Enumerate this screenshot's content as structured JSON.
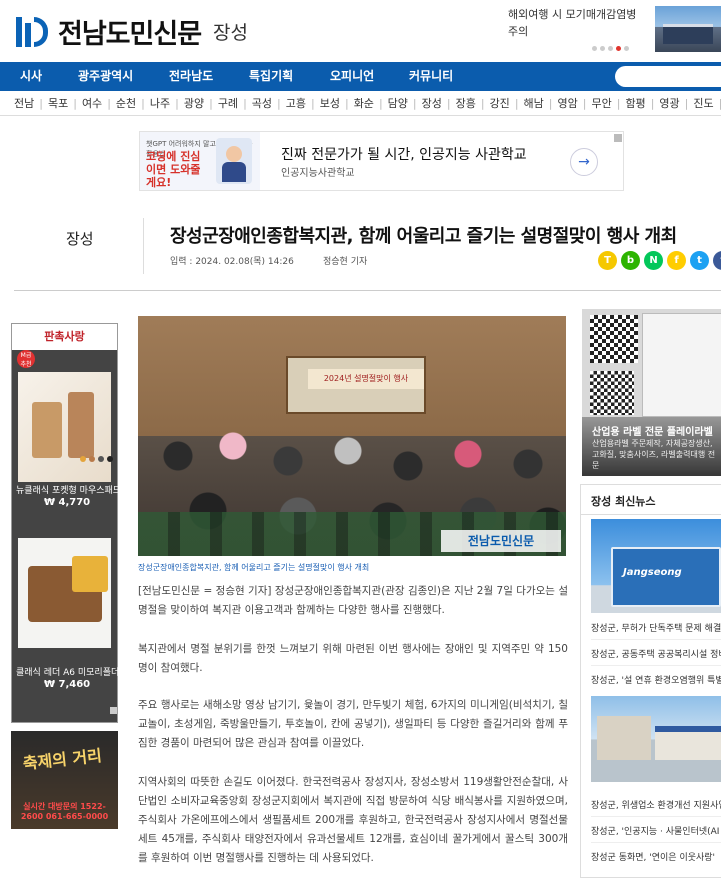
{
  "header": {
    "logo_text": "전남도민신문",
    "region": "장성",
    "promo_text": "해외여행 시 모기매개감염병 주의"
  },
  "nav": {
    "items": [
      "시사",
      "광주광역시",
      "전라남도",
      "특집기획",
      "오피니언",
      "커뮤니티"
    ]
  },
  "regions": [
    "전남",
    "목포",
    "여수",
    "순천",
    "나주",
    "광양",
    "구례",
    "곡성",
    "고흥",
    "보성",
    "화순",
    "담양",
    "장성",
    "장흥",
    "강진",
    "해남",
    "영암",
    "무안",
    "함평",
    "영광",
    "진도",
    "완도",
    "신안"
  ],
  "ad_banner": {
    "thumb_small": "챗GPT 어려워하지 말고 돈을 부르는 활용법",
    "thumb_big": "코딩에 진심이면 도와줄게요!",
    "title": "진짜 전문가가 될 시간, 인공지능 사관학교",
    "subtitle": "인공지능사관학교",
    "arrow": "→"
  },
  "article": {
    "category": "장성",
    "headline": "장성군장애인종합복지관, 함께 어울리고 즐기는 설명절맞이 행사 개최",
    "date": "입력 : 2024. 02.08(목) 14:26",
    "reporter": "정승현 기자",
    "caption": "장성군장애인종합복지관, 함께 어울리고 즐기는 설명절맞이 행사 개최",
    "photo_banner": "2024년 설명절맞이 행사",
    "watermark": "전남도민신문",
    "paragraphs": [
      "[전남도민신문 = 정승현 기자] 장성군장애인종합복지관(관장 김종인)은 지난 2월 7일 다가오는 설명절을 맞이하여 복지관 이용고객과 함께하는 다양한 행사를 진행했다.",
      "복지관에서 명절 분위기를 한껏 느껴보기 위해 마련된 이번 행사에는 장애인 및 지역주민 약 150명이 참여했다.",
      "주요 행사로는 새해소망 영상 남기기, 윷놀이 경기, 만두빚기 체험, 6가지의 미니게임(비석치기, 칠교놀이, 초성게임, 죽방울만들기, 투호놀이, 칸에 공넣기), 생일파티 등 다양한 즐길거리와 함께 푸짐한 경품이 마련되어 많은 관심과 참여를 이끌었다.",
      "지역사회의 따뜻한 손길도 이어졌다. 한국전력공사 장성지사, 장성소방서 119생활안전순찰대, 사단법인 소비자교육중앙회 장성군지회에서 복지관에 직접 방문하여 식당 배식봉사를 지원하였으며, 주식회사 가온에프에스에서 생필품세트 200개를 후원하고, 한국전력공사 장성지사에서 명절선물세트 45개를, 주식회사 태양전자에서 유과선물세트 12개를, 효심이네 꿀가게에서 꿀스틱 300개를 후원하여 이번 명절행사를 진행하는 데 사용되었다."
    ]
  },
  "share": [
    {
      "label": "T",
      "color": "#f5c800"
    },
    {
      "label": "b",
      "color": "#2db400"
    },
    {
      "label": "N",
      "color": "#03c75a"
    },
    {
      "label": "f",
      "color": "#ffcd00"
    },
    {
      "label": "t",
      "color": "#1da1f2"
    },
    {
      "label": "f",
      "color": "#3b5998"
    }
  ],
  "left_ad": {
    "brand": "판촉사랑",
    "badge": "M급 추천",
    "item1_name": "뉴클래식 포켓형 마우스패드",
    "item1_price": "₩ 4,770",
    "item2_name": "클래식 레더 A6 미모리폴더",
    "item2_price": "₩ 7,460",
    "dots": [
      "#e4a43b",
      "#b87a4a",
      "#555",
      "#222"
    ]
  },
  "left_ad2": {
    "title": "축제의 거리",
    "phone": "실시간 대방문의 1522-2600 061-665-0000"
  },
  "right_ad": {
    "title": "산업용 라벨 전문 플레이라벨",
    "desc": "산업용라벨 주문제작, 자체공장생산, 고화질, 맞춤사이즈, 라벨출력대행 전문"
  },
  "latest_news": {
    "title": "장성 최신뉴스",
    "img_text": "Jangseong",
    "items": [
      "장성군, 무허가 단독주택 문제 해결",
      "장성군, 공동주택 공공복리시설 정비",
      "장성군, '설 연휴 환경오염행위 특별",
      "장성군, 위생업소 환경개선 지원사업",
      "장성군, '인공지능 · 사물인터넷(AI",
      "장성군 동화면, '연이은 이웃사랑'"
    ]
  }
}
